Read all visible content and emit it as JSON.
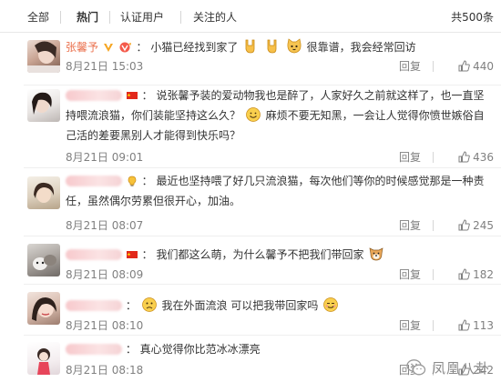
{
  "tabs": {
    "all": "全部",
    "hot": "热门",
    "verified": "认证用户",
    "following": "关注的人",
    "total": "共500条"
  },
  "comments": [
    {
      "username": "张馨予",
      "colon": "：",
      "text_a": "小猫已经找到家了",
      "text_b": "很靠谱，我会经常回访",
      "time": "8月21日 15:03",
      "reply": "回复",
      "likes": "440",
      "icons": [
        "verified-v-icon",
        "vip-icon",
        "rock-hand-emoji",
        "rock-hand-emoji",
        "cat-face-emoji"
      ]
    },
    {
      "colon": "：",
      "text_a": "说张馨予装的爱动物我也是醉了，人家好久之前就这样了，也一直坚持喂流浪猫，你们装能坚持这么久？",
      "text_b": "麻烦不要无知黑，一会让人觉得你愤世嫉俗自己活的差要黑别人才能得到快乐吗？",
      "time": "8月21日 09:01",
      "reply": "回复",
      "likes": "436",
      "icons": [
        "china-flag-icon",
        "smile-emoji"
      ]
    },
    {
      "colon": "：",
      "text_a": "最近也坚持喂了好几只流浪猫，每次他们等你的时候感觉那是一种责任，虽然偶尔劳累但很开心，加油。",
      "time": "8月21日 08:07",
      "reply": "回复",
      "likes": "245",
      "icons": [
        "bulb-badge-icon"
      ]
    },
    {
      "colon": "：",
      "text_a": "我们都这么萌，为什么馨予不把我们带回家",
      "time": "8月21日 08:09",
      "reply": "回复",
      "likes": "182",
      "icons": [
        "china-flag-icon",
        "dog-face-emoji"
      ]
    },
    {
      "colon": "：",
      "text_a": "我在外面流浪 可以把我带回家吗",
      "time": "8月21日 08:10",
      "reply": "回复",
      "likes": "113",
      "icons": [
        "sad-face-emoji",
        "smirk-emoji"
      ]
    },
    {
      "colon": "：",
      "text_a": "真心觉得你比范冰冰漂亮",
      "time": "8月21日 08:18",
      "reply": "回复",
      "likes": "242",
      "icons": []
    }
  ],
  "watermark": {
    "text": "凤凰八卦",
    "icon": "wechat-icon"
  },
  "colors": {
    "username": "#eb7350",
    "meta": "#808080",
    "text": "#333333",
    "separator": "#efefef"
  }
}
